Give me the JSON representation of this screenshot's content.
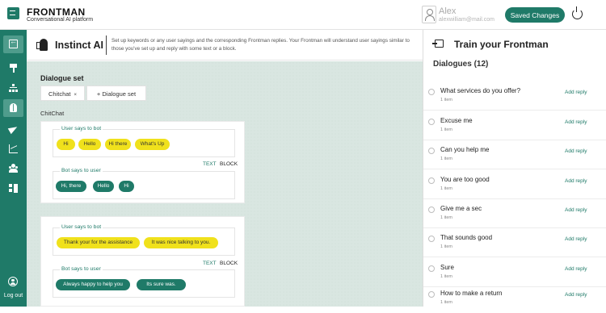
{
  "header": {
    "brand": "FRONTMAN",
    "tagline": "Conversational AI platform",
    "user_name": "Alex",
    "user_email": "alexwilliam@mail.com",
    "save_label": "Saved Changes"
  },
  "sidebar": {
    "logout_label": "Log out"
  },
  "module": {
    "title": "Instinct AI",
    "description": "Set up keywords or any user sayings and the corresponding Frontman replies. Your Frontman will understand user sayings similar to those you've set up and reply with some text or a block."
  },
  "main": {
    "section_title": "Dialogue set",
    "tabs": [
      {
        "label": "Chitchat",
        "close": "×"
      },
      {
        "label": "+ Dialogue set"
      }
    ],
    "current_set": "ChitChat",
    "user_says_label": "User says to bot",
    "bot_says_label": "Bot says to user",
    "text_toggle": "TEXT",
    "block_toggle": "BLOCK",
    "cards": [
      {
        "user_chips": [
          "Hi",
          "Hello",
          "Hi there",
          "What's Up"
        ],
        "bot_chips": [
          "Hi, there",
          "Hello",
          "Hi"
        ]
      },
      {
        "user_chips": [
          "Thank your for the assistance",
          "It was nice talking to you."
        ],
        "bot_chips": [
          "Always happy to help you",
          "Its sure was."
        ]
      }
    ]
  },
  "train_panel": {
    "title": "Train your Frontman",
    "subtitle": "Dialogues (12)",
    "add_reply_label": "Add reply",
    "dialogues": [
      {
        "question": "What services do you offer?",
        "items": "1 item"
      },
      {
        "question": "Excuse me",
        "items": "1 item"
      },
      {
        "question": "Can you help me",
        "items": "1 item"
      },
      {
        "question": "You are too good",
        "items": "1 item"
      },
      {
        "question": "Give me a sec",
        "items": "1 item"
      },
      {
        "question": "That sounds good",
        "items": "1 item"
      },
      {
        "question": "Sure",
        "items": "1 item"
      },
      {
        "question": "How to make a return",
        "items": "1 item"
      }
    ]
  },
  "colors": {
    "primary": "#1f7a68",
    "user_chip": "#f0e11c",
    "sidebar_active": "#4f9c8c",
    "canvas": "#d9e6e1"
  }
}
